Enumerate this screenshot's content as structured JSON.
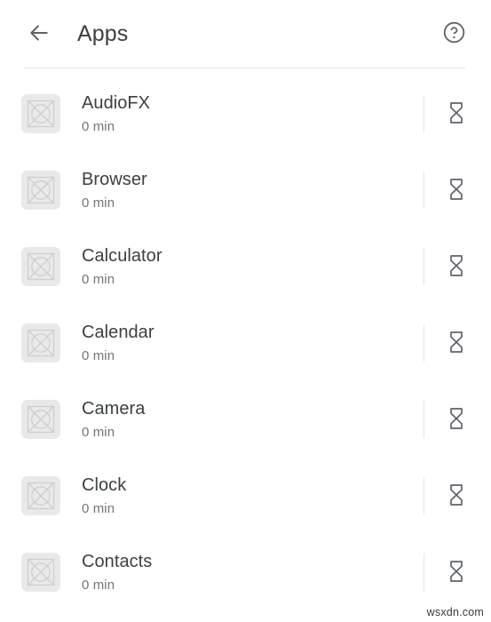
{
  "header": {
    "title": "Apps",
    "back_icon": "arrow-left-icon",
    "help_icon": "help-circle-icon"
  },
  "app_list": {
    "icon_placeholder": "broken-image-placeholder-icon",
    "timer_icon": "hourglass-icon",
    "rows": [
      {
        "name": "AudioFX",
        "duration": "0 min"
      },
      {
        "name": "Browser",
        "duration": "0 min"
      },
      {
        "name": "Calculator",
        "duration": "0 min"
      },
      {
        "name": "Calendar",
        "duration": "0 min"
      },
      {
        "name": "Camera",
        "duration": "0 min"
      },
      {
        "name": "Clock",
        "duration": "0 min"
      },
      {
        "name": "Contacts",
        "duration": "0 min"
      }
    ]
  },
  "watermark": {
    "text": "wsxdn.com"
  },
  "colors": {
    "background": "#ffffff",
    "title_text": "#3c4043",
    "primary_text": "#3c4043",
    "secondary_text": "#70757a",
    "icon_stroke": "#5f6368",
    "placeholder_fill": "#e9e9ea",
    "placeholder_stroke": "#cfcfd1",
    "divider": "#ebebeb",
    "row_divider": "#e4e4e6"
  }
}
